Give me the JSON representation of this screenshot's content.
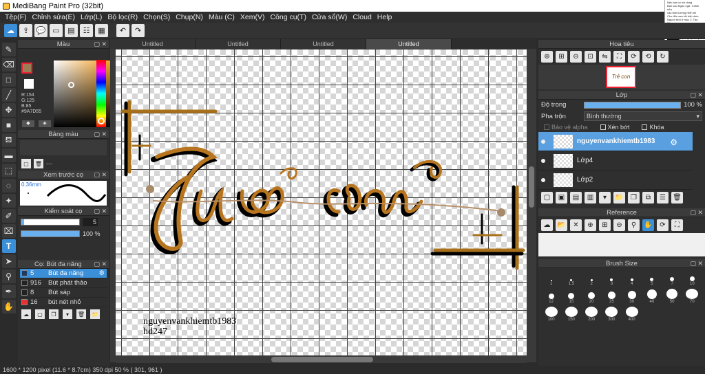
{
  "window": {
    "title": "MediBang Paint Pro (32bit)"
  },
  "thumb_overlay": {
    "lines": [
      "Nếu bạn có sử dụng",
      "Bạn vào Ngôn ngữ: Chỉnh sửa",
      "vào Môi trường Hiển thị",
      "Cho đến sau khi bật chức",
      "Nguồn thời ở mục 2. Tạo Bảng",
      "4. Đặt tên ngôn ngữ 2 tệp",
      "Kỷ điểm bày tỏ, dùng Thanh",
      "Sau khi: 5 Ông Chủ Nhân Tô",
      "6. Loại bỏ phù hợp, đi từ",
      "7. Đặt sao bảng Ngôn ngữ lại",
      "vả cài đông lại cho đồ nghệ sĩ"
    ]
  },
  "menu": [
    "Tệp(F)",
    "Chỉnh sửa(E)",
    "Lớp(L)",
    "Bộ lọc(R)",
    "Chọn(S)",
    "Chụp(N)",
    "Màu (C)",
    "Xem(V)",
    "Công cụ(T)",
    "Cửa sổ(W)",
    "Cloud",
    "Help"
  ],
  "tabs": [
    "Untitled",
    "Untitled",
    "Untitled",
    "Untitled"
  ],
  "active_tab": 3,
  "color_panel": {
    "title": "Màu",
    "current_color": "#9A7D55",
    "r": "R:154",
    "g": "G:125",
    "b": "B:85",
    "hex": "#9A7D55"
  },
  "palette_panel": {
    "title": "Bảng màu",
    "placeholder": "---"
  },
  "brush_preview": {
    "title": "Xem trước cọ",
    "size": "0.36mm"
  },
  "brush_control": {
    "title": "Kiểm soát cọ",
    "size_value": "5",
    "opacity_value": "100 %",
    "size_fill": 0.85,
    "opacity_fill": 1.0
  },
  "brush_list": {
    "title": "Cọ: Bút đa năng",
    "items": [
      {
        "num": "5",
        "name": "Bút đa năng",
        "color": "#1e3a5f",
        "selected": true
      },
      {
        "num": "916",
        "name": "Bút phát thảo",
        "color": "#222222",
        "selected": false
      },
      {
        "num": "8",
        "name": "Bút sáp",
        "color": "#222222",
        "selected": false
      },
      {
        "num": "16",
        "name": "bút nét nhỏ",
        "color": "#e23232",
        "selected": false
      }
    ]
  },
  "canvas": {
    "handwriting_line1": "nguyenvankhiemtb1983",
    "handwriting_line2": "hd247"
  },
  "navigator": {
    "title": "Hoa tiêu",
    "thumb_text": "Trẻ con"
  },
  "layers": {
    "title": "Lớp",
    "opacity_label": "Độ trong",
    "opacity_value": "100 %",
    "blend_label": "Pha trộn",
    "blend_value": "Bình thường",
    "protect_alpha": "Bảo vệ alpha",
    "clipping": "Xén bớt",
    "lock": "Khóa",
    "items": [
      {
        "name": "nguyenvankhiemtb1983",
        "selected": true
      },
      {
        "name": "Lớp4",
        "selected": false
      },
      {
        "name": "Lớp2",
        "selected": false
      }
    ]
  },
  "reference": {
    "title": "Reference"
  },
  "brush_size": {
    "title": "Brush Size",
    "sizes": [
      "1",
      "1.5",
      "2",
      "3",
      "4",
      "5",
      "7",
      "10",
      "12",
      "15",
      "20",
      "25",
      "30",
      "40",
      "50",
      "70",
      "100",
      "150",
      "200",
      "300",
      "400"
    ]
  },
  "status": {
    "text": "1600 * 1200 pixel   (11.6 * 8.7cm)  350 dpi  50 %   ( 301, 961 )"
  }
}
